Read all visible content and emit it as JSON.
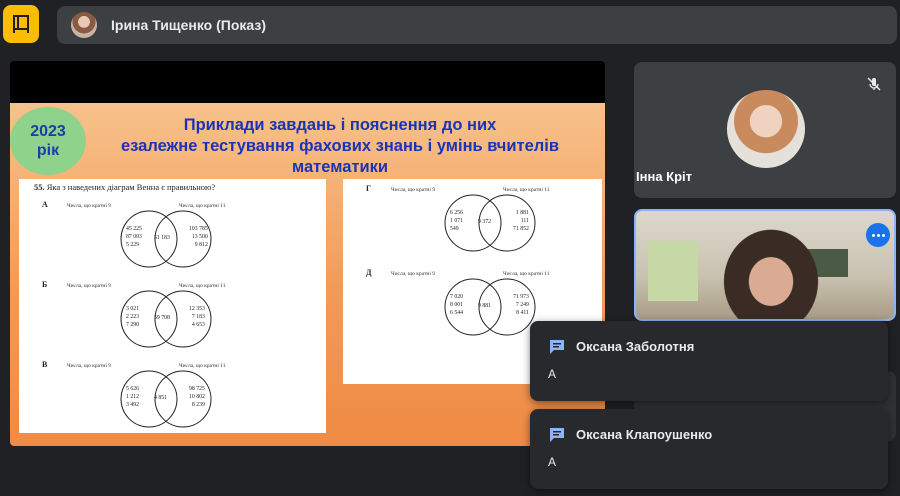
{
  "header": {
    "presenter_label": "Ірина Тищенко (Показ)"
  },
  "slide": {
    "year_badge": [
      "2023",
      "рік"
    ],
    "title_lines": [
      "Приклади завдань і пояснення до них",
      "езалежне тестування фахових знань і умінь вчителів",
      "математики"
    ],
    "question": {
      "number": "55.",
      "text": "Яка з наведених діаграм Венна є правильною?"
    },
    "options": [
      {
        "letter": "А",
        "left_caption": "Числа, що кратні 9",
        "right_caption": "Числа, що кратні 11",
        "left_numbers": "45 225\n87 003\n5 229",
        "middle_numbers": "51 183",
        "right_numbers": "103 785\n13 500\n9 812"
      },
      {
        "letter": "Б",
        "left_caption": "Числа, що кратні 9",
        "right_caption": "Числа, що кратні 11",
        "left_numbers": "3 021\n2 223\n7 290",
        "middle_numbers": "59 708",
        "right_numbers": "12 353\n7 183\n4 653"
      },
      {
        "letter": "В",
        "left_caption": "Числа, що кратні 9",
        "right_caption": "Числа, що кратні 11",
        "left_numbers": "5 626\n1 212\n3 492",
        "middle_numbers": "4 851",
        "right_numbers": "98 725\n10 802\n8 239"
      },
      {
        "letter": "Г",
        "left_caption": "Числа, що кратні 9",
        "right_caption": "Числа, що кратні 11",
        "left_numbers": "6 256\n1 071\n549",
        "middle_numbers": "9 372",
        "right_numbers": "1 881\n111\n71 852"
      },
      {
        "letter": "Д",
        "left_caption": "Числа, що кратні 9",
        "right_caption": "Числа, що кратні 11",
        "left_numbers": "7 020\n8 001\n6 544",
        "middle_numbers": "9 881",
        "right_numbers": "71 973\n7 249\n8 411"
      }
    ]
  },
  "participants": [
    {
      "name": "Інна Кріт",
      "muted": true
    }
  ],
  "chat_toasts": [
    {
      "name": "Оксана Заболотня",
      "message": "A"
    },
    {
      "name": "Оксана Клапоушенко",
      "message": "A"
    }
  ],
  "icons": {
    "present": "presentation-icon",
    "mute": "mic-off-icon",
    "more": "more-options-icon",
    "chat": "chat-icon"
  },
  "colors": {
    "accent_blue": "#1a73e8",
    "highlight_border": "#8ab4f8",
    "logo_yellow": "#fbbc04",
    "slide_title": "#1a34b8"
  }
}
